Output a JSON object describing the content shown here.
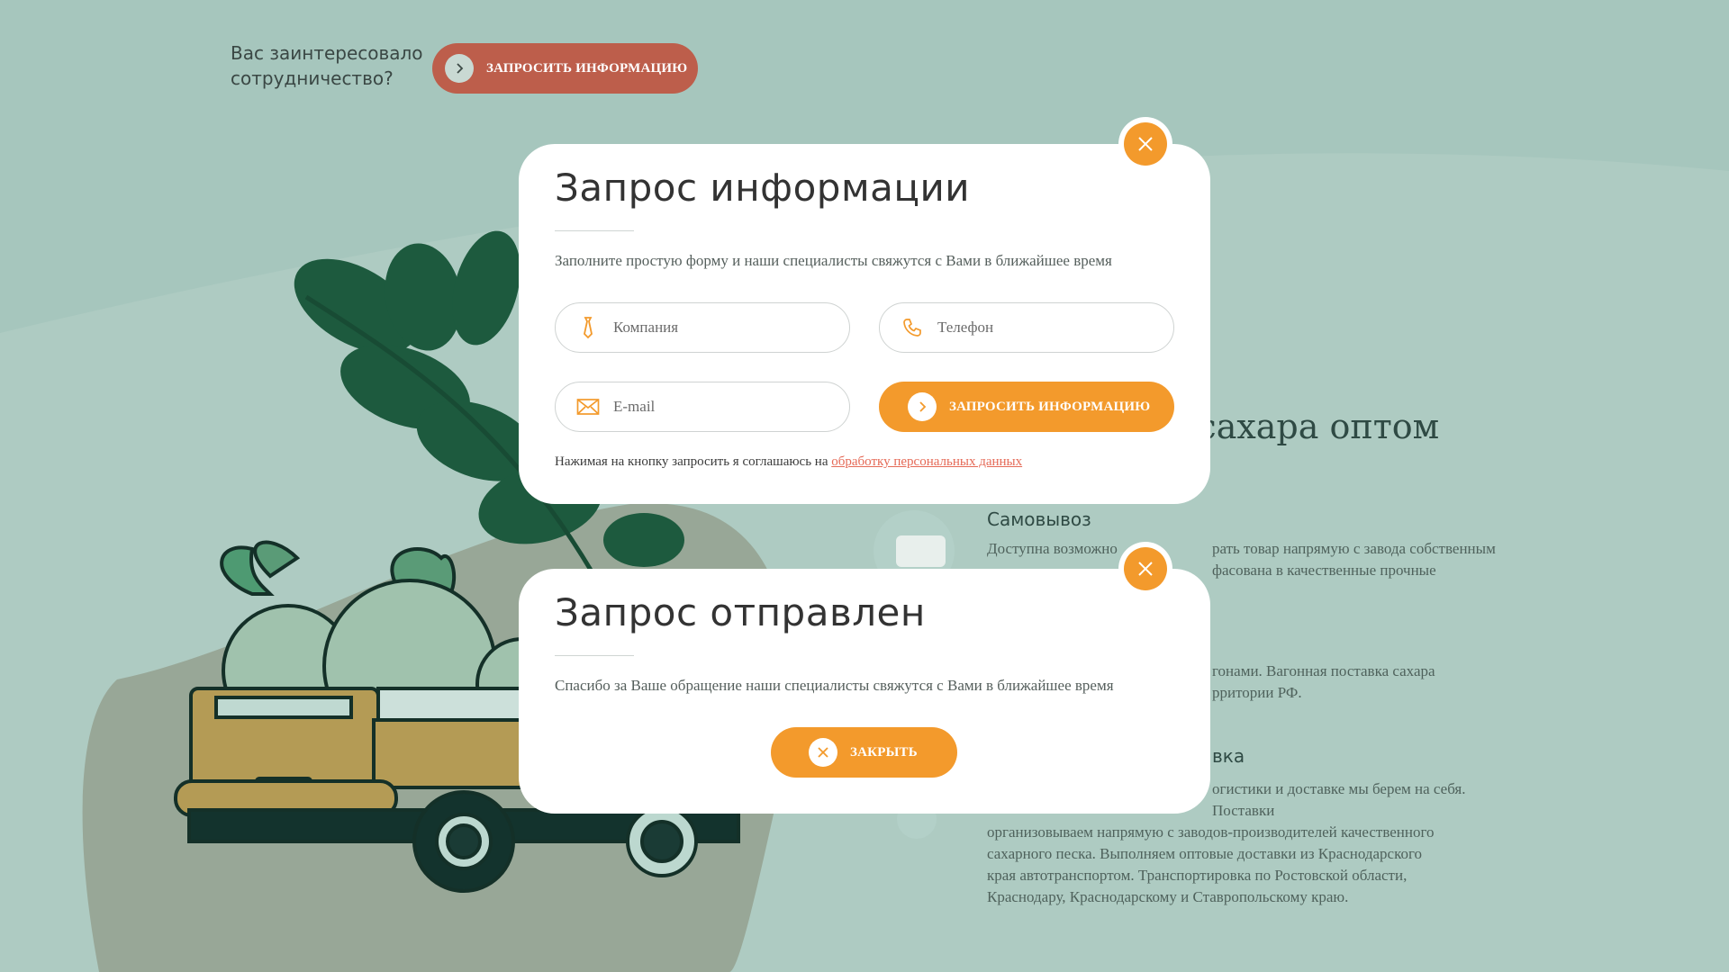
{
  "colors": {
    "background": "#a6c6bd",
    "accent": "#f39a2c",
    "cta": "#bd5e4b",
    "link": "#e56a57"
  },
  "cta": {
    "text": "Вас заинтересовало\nсотрудничество?",
    "button_label": "Запросить информацию",
    "button_icon": "chevron-right-icon"
  },
  "section": {
    "title": "и сахара оптом",
    "deliveries": [
      {
        "title": "Самовывоз",
        "lines": [
          "Доступна возможно",
          "рать товар напрямую с завода собственным",
          "фасована в качественные прочные"
        ]
      },
      {
        "lines": [
          "гонами. Вагонная поставка сахара",
          "рритории РФ."
        ]
      },
      {
        "title": "вка",
        "lines": [
          "огистики и доставке мы берем на себя.",
          "Поставки",
          "организовываем напрямую с заводов-производителей качественного",
          "сахарного песка. Выполняем оптовые доставки из Краснодарского",
          "края автотранспортом. Транспортировка по Ростовской области,",
          "Краснодару, Краснодарскому и Ставропольскому краю."
        ]
      }
    ]
  },
  "request_modal": {
    "title": "Запрос информации",
    "subtitle": "Заполните простую форму и наши специалисты свяжутся с Вами в ближайшее время",
    "fields": {
      "company": {
        "placeholder": "Компания",
        "value": "",
        "icon": "tie-icon"
      },
      "phone": {
        "placeholder": "Телефон",
        "value": "",
        "icon": "phone-icon"
      },
      "email": {
        "placeholder": "E-mail",
        "value": "",
        "icon": "mail-icon"
      }
    },
    "submit_label": "Запросить информацию",
    "consent_text": "Нажимая на кнопку запросить я соглашаюсь на",
    "consent_link": "обработку персональных данных",
    "close_icon": "close-icon"
  },
  "sent_modal": {
    "title": "Запрос отправлен",
    "message": "Спасибо за Ваше обращение наши специалисты свяжутся с Вами в ближайшее время",
    "close_label": "Закрыть",
    "close_icon": "close-icon"
  }
}
